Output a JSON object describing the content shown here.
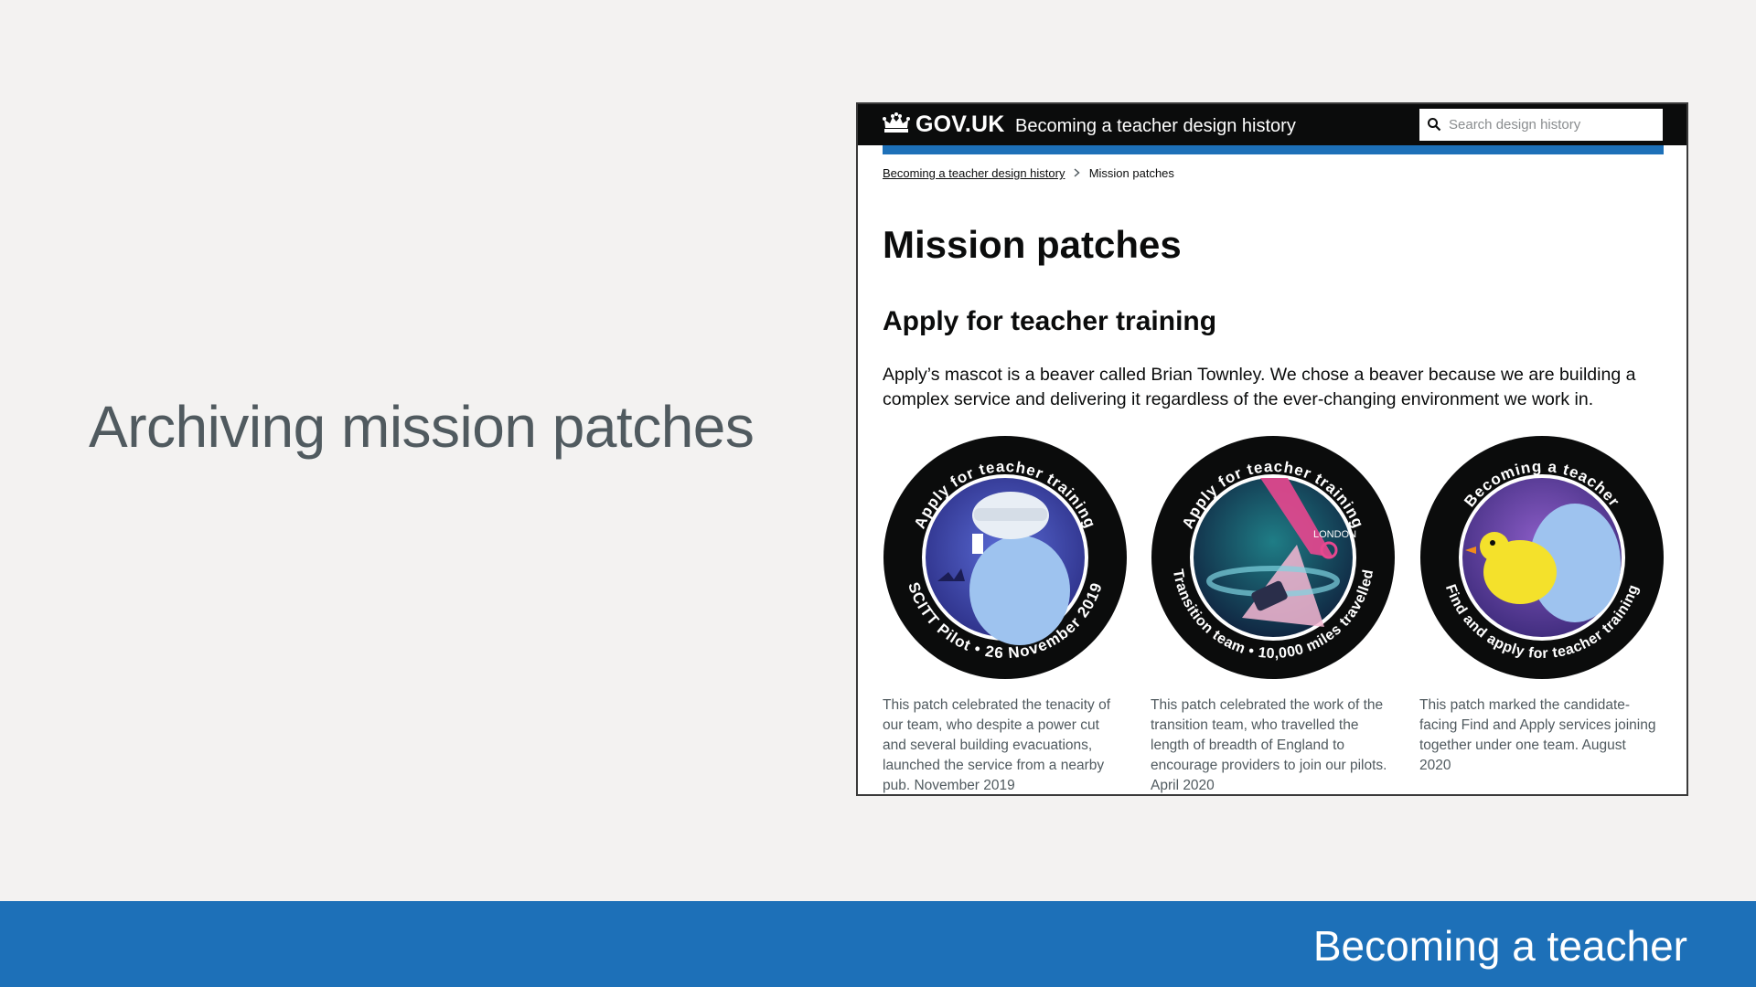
{
  "slide": {
    "title": "Archiving mission patches",
    "footer_text": "Becoming a teacher",
    "footer_color": "#1d70b8"
  },
  "screenshot": {
    "header": {
      "logo_text": "GOV.UK",
      "service_name": "Becoming a teacher design history",
      "search_placeholder": "Search design history",
      "icons": [
        "crown-icon",
        "search-icon"
      ]
    },
    "breadcrumb": {
      "parent": "Becoming a teacher design history",
      "current": "Mission patches"
    },
    "page_title": "Mission patches",
    "section_heading": "Apply for teacher training",
    "lede": "Apply’s mascot is a beaver called Brian Townley. We chose a beaver because we are building a complex service and delivering it regardless of the ever-changing environment we work in.",
    "patches": [
      {
        "top_text": "Apply for teacher training",
        "bottom_text": "SCITT Pilot • 26 November 2019",
        "caption": "This patch celebrated the tenacity of our team, who despite a power cut and several building evacuations, launched the service from a nearby pub. November 2019"
      },
      {
        "top_text": "Apply for teacher training",
        "bottom_text": "Transition team • 10,000 miles travelled",
        "inner_label": "LONDON",
        "caption": "This patch celebrated the work of the transition team, who travelled the length of breadth of England to encourage providers to join our pilots. April 2020"
      },
      {
        "top_text": "Becoming a teacher",
        "bottom_text": "Find and apply for teacher training",
        "caption": "This patch marked the candidate-facing Find and Apply services joining together under one team. August 2020"
      }
    ]
  }
}
